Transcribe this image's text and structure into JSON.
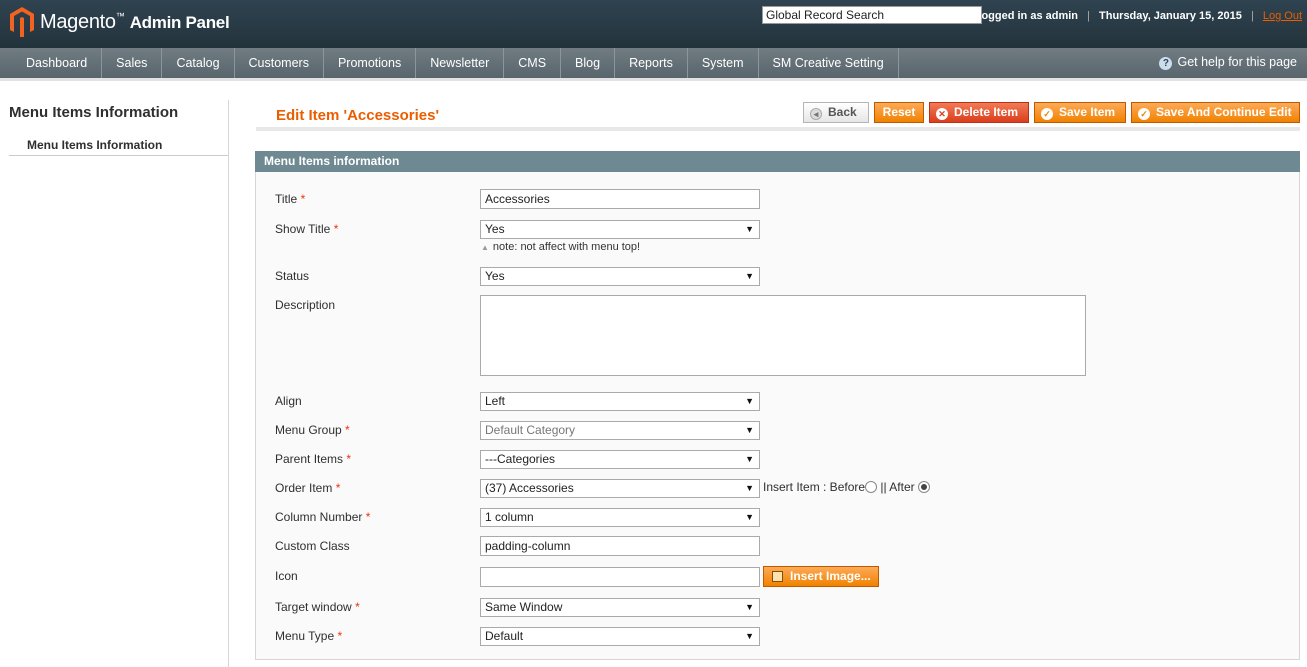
{
  "header": {
    "brand": "Magento",
    "trademark": "™",
    "subtitle": "Admin Panel",
    "search_value": "Global Record Search",
    "logged_in": "Logged in as admin",
    "date": "Thursday, January 15, 2015",
    "logout": "Log Out",
    "separator": "|"
  },
  "nav": {
    "items": [
      "Dashboard",
      "Sales",
      "Catalog",
      "Customers",
      "Promotions",
      "Newsletter",
      "CMS",
      "Blog",
      "Reports",
      "System",
      "SM Creative Setting"
    ],
    "help": "Get help for this page",
    "help_icon": "question-icon"
  },
  "sidebar": {
    "title": "Menu Items Information",
    "tab": "Menu Items Information"
  },
  "page": {
    "title": "Edit Item 'Accessories'",
    "buttons": {
      "back": "Back",
      "reset": "Reset",
      "delete": "Delete Item",
      "save": "Save Item",
      "save_continue": "Save And Continue Edit"
    }
  },
  "form": {
    "section_title": "Menu Items information",
    "required_mark": "*",
    "fields": {
      "title": {
        "label": "Title",
        "value": "Accessories"
      },
      "show_title": {
        "label": "Show Title",
        "value": "Yes",
        "note": "note: not affect with menu top!"
      },
      "status": {
        "label": "Status",
        "value": "Yes"
      },
      "description": {
        "label": "Description",
        "value": ""
      },
      "align": {
        "label": "Align",
        "value": "Left"
      },
      "menu_group": {
        "label": "Menu Group",
        "value": "Default Category"
      },
      "parent_items": {
        "label": "Parent Items",
        "value": "---Categories"
      },
      "order_item": {
        "label": "Order Item",
        "value": "(37) Accessories",
        "insert_label": "Insert Item : Before",
        "sep": "||",
        "after_label": "After",
        "selected": "After"
      },
      "column_number": {
        "label": "Column Number",
        "value": "1 column"
      },
      "custom_class": {
        "label": "Custom Class",
        "value": "padding-column"
      },
      "icon": {
        "label": "Icon",
        "value": "",
        "button": "Insert Image..."
      },
      "target_window": {
        "label": "Target window",
        "value": "Same Window"
      },
      "menu_type": {
        "label": "Menu Type",
        "value": "Default"
      }
    }
  },
  "colors": {
    "accent": "#eb5e00",
    "header_bg": "#2f4350",
    "nav_bg": "#6a767c",
    "section_head": "#6f8992"
  }
}
